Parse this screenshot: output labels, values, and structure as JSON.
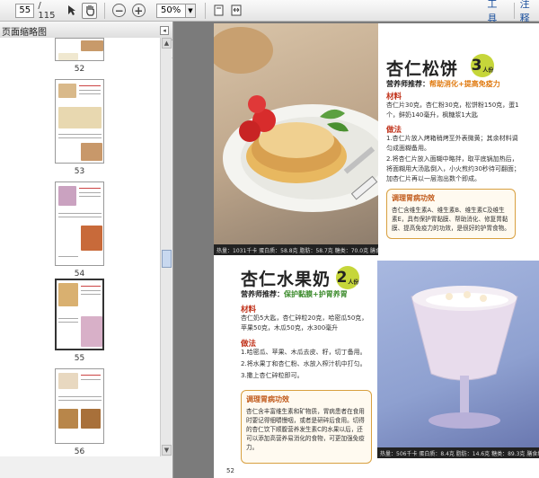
{
  "toolbar": {
    "current_page": "55",
    "page_total": "/ 115",
    "zoom": "50%",
    "tools_label": "工具",
    "comment_label": "注释"
  },
  "panel": {
    "title": "页面缩略图",
    "thumbnails": [
      {
        "label": "52"
      },
      {
        "label": "53"
      },
      {
        "label": "54"
      },
      {
        "label": "55"
      },
      {
        "label": "56"
      }
    ]
  },
  "recipe1": {
    "title": "杏仁松饼",
    "badge": "3",
    "badge_unit": "人份",
    "recommend_prefix": "营养师推荐：",
    "recommend_value": "帮助消化+提高免疫力",
    "materials_title": "材料",
    "materials_text": "杏仁片30克，杏仁粉30克，松饼粉150克，蛋1个，鲜奶140毫升，枫糖浆1大匙",
    "steps_title": "做法",
    "step1": "1.杏仁片放入烤箱稍烤至外表微黄；其余材料调匀成面糊备用。",
    "step2": "2.将杏仁片放入面糊中略拌，取平底锅加热后，将面糊用大汤匙倒入，小火煎约30秒待可翻面；加杏仁片再以一层泡出数个即成。",
    "tip_title": "调理胃病功效",
    "tip_text": "杏仁含维生素A、维生素B、维生素C及维生素E，具有保护胃黏膜、帮助消化、修复胃黏膜、提高免疫力的功效，是很好的护胃食物。",
    "nutrition": "热量：1031千卡  蛋白质：58.8克  脂肪：58.7克  糖类：70.0克  膳食纤维：14.0克"
  },
  "recipe2": {
    "title": "杏仁水果奶",
    "badge": "2",
    "badge_unit": "人份",
    "recommend_prefix": "营养师推荐：",
    "recommend_value": "保护黏膜+护胃养胃",
    "materials_title": "材料",
    "materials_text": "杏仁奶5大匙，杏仁碎粒20克，哈密瓜50克，苹果50克，木瓜50克，水300毫升",
    "steps_title": "做法",
    "step1": "1.哈密瓜、苹果、木瓜去皮、籽，切丁备用。",
    "step2": "2.将水果丁和杏仁粉、水放入榨汁机中打匀。",
    "step3": "3.撒上杏仁碎粒即可。",
    "tip_title": "调理胃病功效",
    "tip_text": "杏仁含丰富维生素和矿物质，胃病患者在食用时要记得细嚼慢咽，或者是研碎后食用。切得的杏仁饮下顺腹营养发生素C的水果以后，还可以添加高营养易消化的食物，可更加强免疫力。",
    "nutrition": "热量：506千卡  蛋白质：8.4克  脂肪：14.6克  糖类：89.3克  膳食纤维：3.5克"
  },
  "page_number": "52"
}
